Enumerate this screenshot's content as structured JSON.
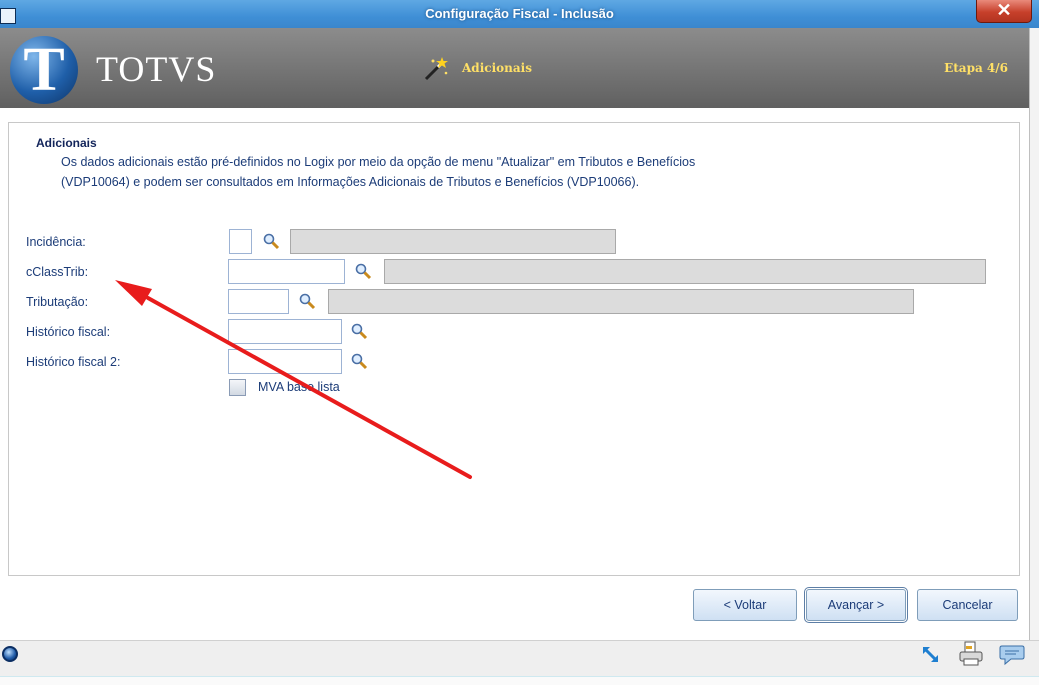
{
  "window": {
    "title": "Configuração Fiscal - Inclusão",
    "close_icon": "close-icon",
    "close_glyph": "✕"
  },
  "header": {
    "logo_text": "TOTVS",
    "logo_letter": "T",
    "step_title": "Adicionais",
    "step_count": "Etapa 4/6",
    "accent_color": "#ffe066"
  },
  "section": {
    "title": "Adicionais",
    "description_line1": "Os dados adicionais estão pré-definidos no Logix por meio da opção de menu \"Atualizar\" em Tributos e Benefícios",
    "description_line2": "(VDP10064) e podem ser consultados em Informações Adicionais de Tributos e Benefícios (VDP10066)."
  },
  "form": {
    "incidencia": {
      "label": "Incidência:",
      "value": "",
      "description": ""
    },
    "cclasstrib": {
      "label": "cClassTrib:",
      "value": "",
      "description": ""
    },
    "tributacao": {
      "label": "Tributação:",
      "value": "",
      "description": ""
    },
    "historico_fiscal": {
      "label": "Histórico fiscal:",
      "value": ""
    },
    "historico_fiscal_2": {
      "label": "Histórico fiscal 2:",
      "value": ""
    },
    "mva_base_lista": {
      "label": "MVA base lista",
      "checked": false
    }
  },
  "buttons": {
    "back": "< Voltar",
    "next": "Avançar >",
    "cancel": "Cancelar"
  },
  "annotation": {
    "arrow_color": "#e81c1c"
  },
  "statusbar": {
    "icons": [
      "totvs-orb-icon",
      "resize-icon",
      "printer-icon",
      "chat-icon"
    ]
  }
}
